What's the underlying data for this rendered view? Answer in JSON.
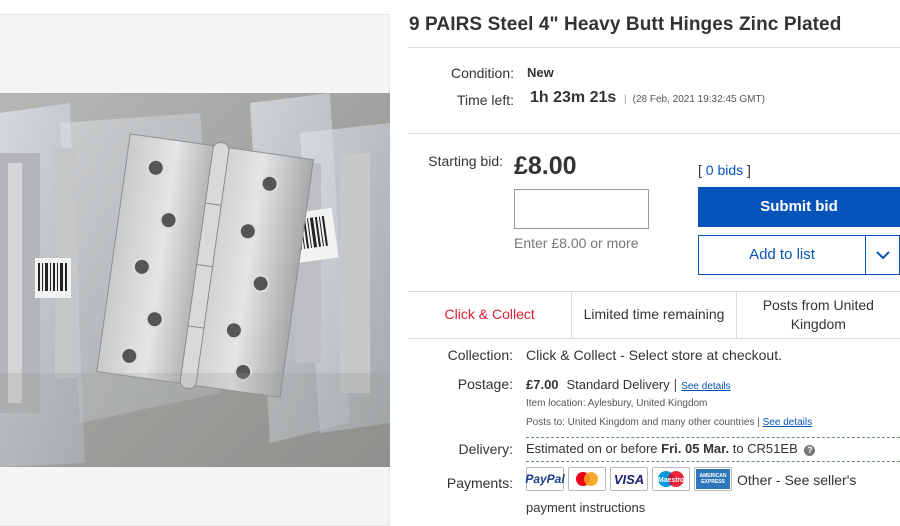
{
  "listing": {
    "title": "9 PAIRS Steel 4\" Heavy Butt Hinges Zinc Plated"
  },
  "image_alt": "hinges-product-photo",
  "details": {
    "condition_label": "Condition:",
    "condition_value": "New",
    "time_left_label": "Time left:",
    "time_left_value": "1h 23m 21s",
    "end_time": "(28 Feb, 2021  19:32:45 GMT)"
  },
  "bid": {
    "starting_bid_label": "Starting bid:",
    "price": "£8.00",
    "bids_text": "0 bids",
    "input_value": "",
    "hint": "Enter £8.00 or more",
    "submit_label": "Submit bid",
    "add_to_list_label": "Add to list"
  },
  "features": [
    "Click & Collect",
    "Limited time remaining",
    "Posts from United Kingdom"
  ],
  "shipping": {
    "collection_label": "Collection:",
    "collection_value": "Click & Collect - Select store at checkout.",
    "postage_label": "Postage:",
    "postage_price": "£7.00",
    "postage_method": "Standard Delivery",
    "see_details": "See details",
    "item_location": "Item location:  Aylesbury, United Kingdom",
    "posts_to": "Posts to:  United Kingdom and many other countries",
    "see_details_2": "See details",
    "delivery_label": "Delivery:",
    "delivery_prefix": "Estimated on or before",
    "delivery_date": "Fri. 05 Mar.",
    "delivery_to": "to CR51EB",
    "payments_label": "Payments:",
    "payment_methods": [
      "PayPal",
      "mastercard",
      "VISA",
      "Maestro",
      "AMERICAN EXPRESS"
    ],
    "payments_other": "Other - See seller's",
    "payments_other_2": "payment instructions"
  },
  "colors": {
    "accent_blue": "#0654ba",
    "click_collect_red": "#dd1e31"
  }
}
